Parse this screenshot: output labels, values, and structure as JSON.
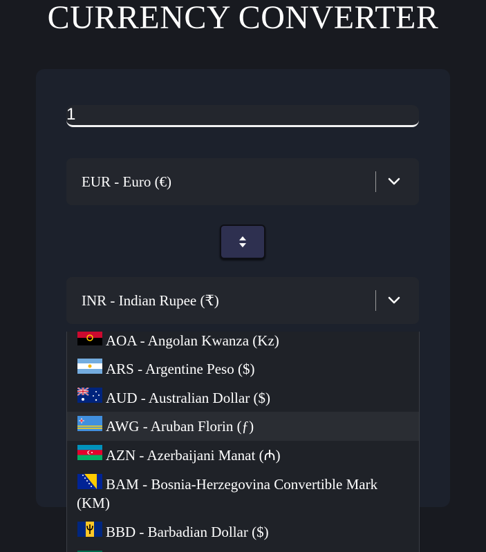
{
  "app": {
    "title": "CURRENCY CONVERTER"
  },
  "amount": {
    "value": "1"
  },
  "from": {
    "label": "EUR - Euro (€)"
  },
  "to": {
    "label": "INR - Indian Rupee (₹)"
  },
  "dropdown": {
    "options": [
      {
        "line1": "AOA - Angolan Kwanza (Kz)"
      },
      {
        "line1": "ARS - Argentine Peso ($)"
      },
      {
        "line1": "AUD - Australian Dollar ($)"
      },
      {
        "line1": "AWG - Aruban Florin (ƒ)"
      },
      {
        "line1": "AZN - Azerbaijani Manat (₼)"
      },
      {
        "line1": "BAM - Bosnia-Herzegovina Convertible Mark",
        "line2": "(KM)"
      },
      {
        "line1": "BBD - Barbadian Dollar ($)"
      }
    ],
    "hovered_index": 3
  },
  "colors": {
    "background": "#181a20",
    "card": "#1c212c",
    "field": "#23262d",
    "swap_button": "#2e3050"
  },
  "icons": {
    "chevron": "chevron-down-icon",
    "swap": "swap-vertical-icon"
  }
}
